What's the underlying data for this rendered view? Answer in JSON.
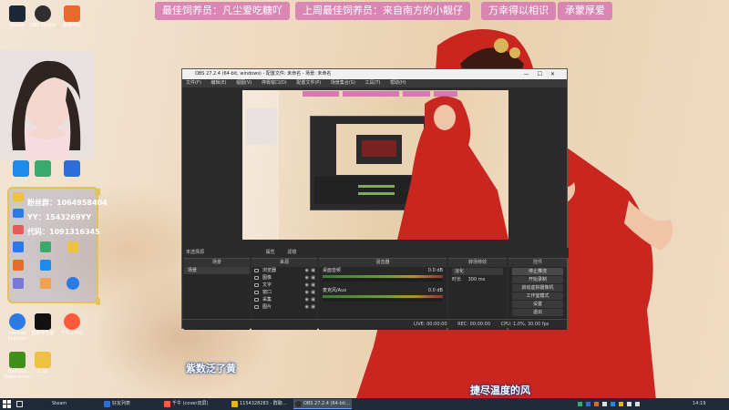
{
  "banners": [
    "最佳饲养员：凡尘爱吃糖吖",
    "上周最佳饲养员：来自南方的小靓仔",
    "万幸得以相识",
    "承蒙厚爱"
  ],
  "desktop_icons_top": [
    {
      "label": "Steam",
      "color": "#1b2838"
    },
    {
      "label": "OBS Studio",
      "color": "#302e31"
    },
    {
      "label": "直播伴侣",
      "color": "#e86a2a"
    }
  ],
  "desktop_icons_left": [
    {
      "label": "",
      "color": "#1e8be8"
    },
    {
      "label": "",
      "color": "#3aa96b"
    },
    {
      "label": "",
      "color": "#2b6fd6"
    },
    {
      "label": "Internet Explorer",
      "color": "#2c7be5"
    },
    {
      "label": "剪映专业版",
      "color": "#111111"
    },
    {
      "label": "千牛工作台",
      "color": "#ff5a3c"
    },
    {
      "label": "GeForce Experience",
      "color": "#3f8f1a"
    },
    {
      "label": "1.txt",
      "color": "#f0c040"
    }
  ],
  "chat_overlay": {
    "line1": "粉丝群：1064958404",
    "line2": "YY：1543269YY",
    "line3": "代码：1091316345"
  },
  "obs": {
    "title": "OBS 27.2.4 (64-bit, windows) - 配置文件: 未命名 - 场景: 未命名",
    "menu": [
      "文件(F)",
      "编辑(E)",
      "视图(V)",
      "停靠窗口(D)",
      "配置文件(P)",
      "场景集合(S)",
      "工具(T)",
      "帮助(H)"
    ],
    "no_source_label": "未选择源",
    "props_label": "属性",
    "filters_label": "滤镜",
    "panels": {
      "scenes": "场景",
      "sources": "来源",
      "mixer": "混音器",
      "transitions": "转场特效",
      "controls": "控件"
    },
    "scenes": [
      "场景"
    ],
    "sources": [
      "浏览器",
      "图像",
      "文字",
      "窗口",
      "采集",
      "图片"
    ],
    "mixer_channels": [
      {
        "name": "桌面音频",
        "value": "0.0 dB"
      },
      {
        "name": "麦克风/Aux",
        "value": "0.0 dB"
      }
    ],
    "transition": {
      "type": "淡化",
      "duration_label": "时长",
      "duration": "300 ms"
    },
    "controls": [
      "停止推流",
      "开始录制",
      "启动虚拟摄像机",
      "工作室模式",
      "设置",
      "退出"
    ],
    "status": {
      "live": "LIVE: 00:00:00",
      "rec": "REC: 00:00:00",
      "cpu": "CPU: 1.0%, 30.00 fps"
    }
  },
  "lyrics": {
    "line1": "紫数泛了黄",
    "line2": "捷尽温度的风"
  },
  "taskbar": {
    "tasks": [
      {
        "label": "Steam",
        "color": "#1b2838",
        "active": false
      },
      {
        "label": "好友列表",
        "color": "#2b6fd6",
        "active": false
      },
      {
        "label": "千牛 (cover双屏)",
        "color": "#ff5a3c",
        "active": false
      },
      {
        "label": "1154328283 - 群聊...",
        "color": "#e8b020",
        "active": false
      },
      {
        "label": "OBS 27.2.4 (64-bit...",
        "color": "#302e31",
        "active": true
      }
    ],
    "time": "14:19"
  }
}
